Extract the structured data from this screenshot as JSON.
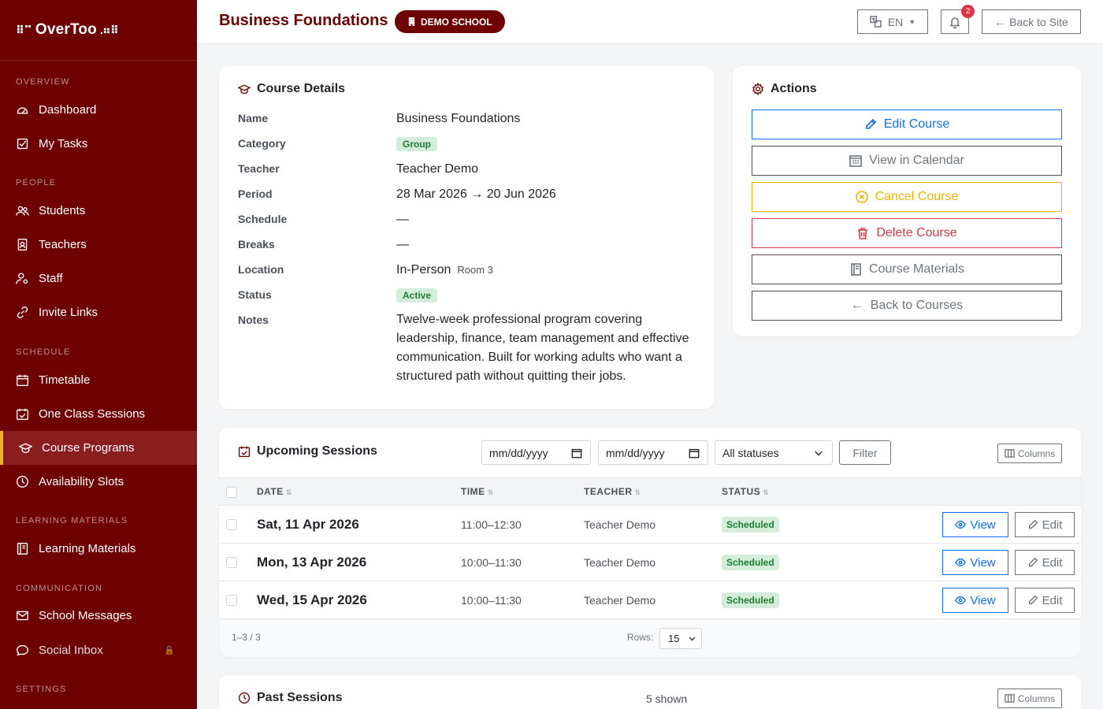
{
  "brand": {
    "name": "OverToo"
  },
  "sidebar": {
    "sections": {
      "overview": "OVERVIEW",
      "people": "PEOPLE",
      "schedule": "SCHEDULE",
      "learning": "LEARNING MATERIALS",
      "communication": "COMMUNICATION",
      "settings": "SETTINGS"
    },
    "items": {
      "dashboard": "Dashboard",
      "tasks": "My Tasks",
      "students": "Students",
      "teachers": "Teachers",
      "staff": "Staff",
      "invite": "Invite Links",
      "timetable": "Timetable",
      "oneclass": "One Class Sessions",
      "programs": "Course Programs",
      "availability": "Availability Slots",
      "materials": "Learning Materials",
      "messages": "School Messages",
      "social": "Social Inbox"
    },
    "active": "Course Programs"
  },
  "header": {
    "title": "Business Foundations",
    "badge": "DEMO SCHOOL",
    "language": "EN",
    "notifications": "2",
    "back_site": "Back to Site"
  },
  "details": {
    "title": "Course Details",
    "labels": {
      "name": "Name",
      "category": "Category",
      "teacher": "Teacher",
      "period": "Period",
      "schedule": "Schedule",
      "breaks": "Breaks",
      "location": "Location",
      "status": "Status",
      "notes": "Notes"
    },
    "values": {
      "name": "Business Foundations",
      "category": "Group",
      "teacher": "Teacher Demo",
      "period": "28 Mar 2026 → 20 Jun 2026",
      "schedule": "—",
      "breaks": "—",
      "location": "In-Person",
      "room": "Room 3",
      "status": "Active",
      "notes": "Twelve-week professional program covering leadership, finance, team management and effective communication. Built for working adults who want a structured path without quitting their jobs."
    }
  },
  "actions": {
    "title": "Actions",
    "edit": "Edit Course",
    "calendar": "View in Calendar",
    "cancel": "Cancel Course",
    "delete": "Delete Course",
    "materials": "Course Materials",
    "back": "Back to Courses",
    "colors": {
      "edit": "#0d6efd",
      "cancel": "#f0b400",
      "delete": "#dc3545",
      "neutral": "#6c757d"
    }
  },
  "upcoming": {
    "title": "Upcoming Sessions",
    "date_from_placeholder": "mm/dd/yyyy",
    "date_to_placeholder": "mm/dd/yyyy",
    "status_filter": "All statuses",
    "filter_button": "Filter",
    "columns_button": "Columns",
    "headers": {
      "date": "DATE",
      "time": "TIME",
      "teacher": "TEACHER",
      "status": "STATUS"
    },
    "rows": [
      {
        "date": "Sat, 11 Apr 2026",
        "time": "11:00–12:30",
        "teacher": "Teacher Demo",
        "status": "Scheduled"
      },
      {
        "date": "Mon, 13 Apr 2026",
        "time": "10:00–11:30",
        "teacher": "Teacher Demo",
        "status": "Scheduled"
      },
      {
        "date": "Wed, 15 Apr 2026",
        "time": "10:00–11:30",
        "teacher": "Teacher Demo",
        "status": "Scheduled"
      }
    ],
    "view_label": "View",
    "edit_label": "Edit",
    "range": "1–3 / 3",
    "rows_label": "Rows:",
    "rows_value": "15"
  },
  "past": {
    "title": "Past Sessions",
    "shown": "5 shown",
    "columns_button": "Columns"
  }
}
